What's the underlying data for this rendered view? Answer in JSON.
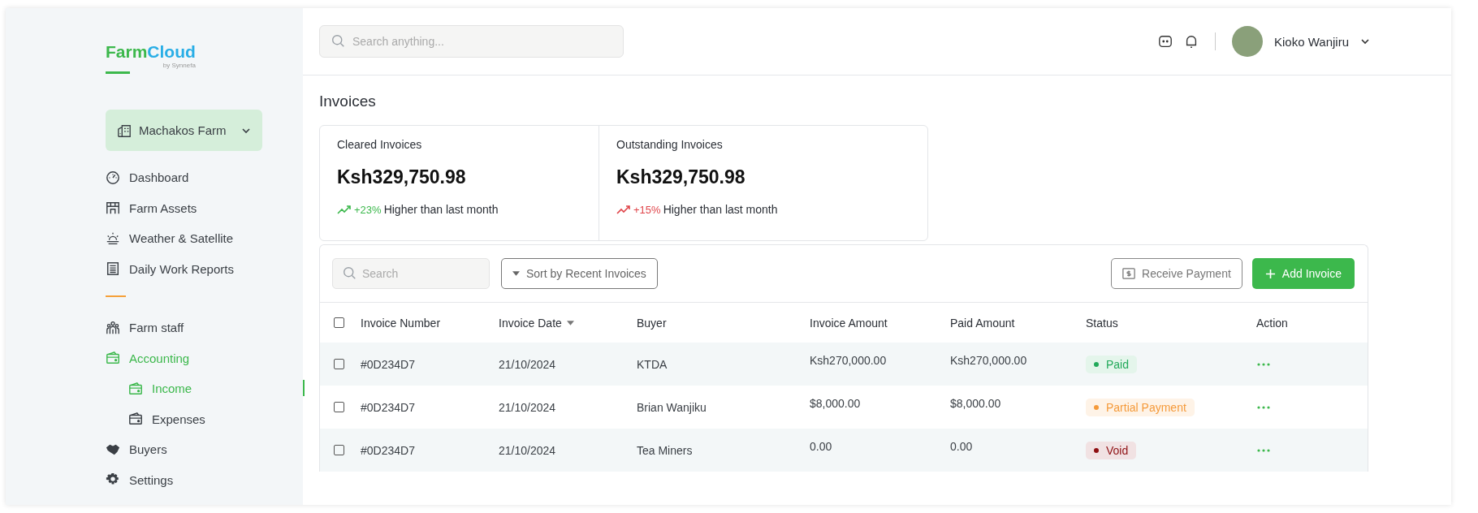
{
  "brand": {
    "first": "Farm",
    "second": "Cloud",
    "tagline": "by Synnefa"
  },
  "farm_selector": {
    "label": "Machakos Farm"
  },
  "sidebar": {
    "groups": [
      {
        "items": [
          {
            "label": "Dashboard",
            "selected": false
          },
          {
            "label": "Farm Assets",
            "selected": false
          },
          {
            "label": "Weather & Satellite",
            "selected": false
          },
          {
            "label": "Daily Work Reports",
            "selected": false
          }
        ]
      },
      {
        "items": [
          {
            "label": "Farm staff",
            "selected": false
          },
          {
            "label": "Accounting",
            "selected": true,
            "children": [
              {
                "label": "Income",
                "selected": true
              },
              {
                "label": "Expenses",
                "selected": false
              }
            ]
          },
          {
            "label": "Buyers",
            "selected": false
          },
          {
            "label": "Settings",
            "selected": false
          }
        ]
      }
    ]
  },
  "topbar": {
    "search": {
      "placeholder": "Search anything..."
    },
    "user": {
      "name": "Kioko Wanjiru"
    }
  },
  "page": {
    "title": "Invoices"
  },
  "stats": [
    {
      "title": "Cleared Invoices",
      "value": "Ksh329,750.98",
      "change": "+23%",
      "color": "#3cb84c",
      "note": "Higher than last month"
    },
    {
      "title": "Outstanding Invoices",
      "value": "Ksh329,750.98",
      "change": "+15%",
      "color": "#e0454a",
      "note": "Higher than last month"
    }
  ],
  "table": {
    "search": {
      "placeholder": "Search"
    },
    "sort_button": "Sort by Recent Invoices",
    "receive_button": "Receive Payment",
    "add_button": "Add Invoice",
    "select_all": {
      "checked": false
    },
    "columns": [
      {
        "label": "Invoice Number",
        "sorted": false
      },
      {
        "label": "Invoice Date",
        "sorted": true
      },
      {
        "label": "Buyer",
        "sorted": false
      },
      {
        "label": "Invoice Amount",
        "sorted": false
      },
      {
        "label": "Paid Amount",
        "sorted": false
      },
      {
        "label": "Status",
        "sorted": false
      },
      {
        "label": "Action",
        "sorted": false
      }
    ],
    "rows": [
      {
        "checked": false,
        "number": "#0D234D7",
        "date": "21/10/2024",
        "buyer": "KTDA",
        "invoice_amount": "Ksh270,000.00",
        "paid_amount": "Ksh270,000.00",
        "status": {
          "label": "Paid",
          "color": "#22a95a"
        }
      },
      {
        "checked": false,
        "number": "#0D234D7",
        "date": "21/10/2024",
        "buyer": "Brian Wanjiku",
        "invoice_amount": "$8,000.00",
        "paid_amount": "$8,000.00",
        "status": {
          "label": "Partial Payment",
          "color": "#f59a3a"
        }
      },
      {
        "checked": false,
        "number": "#0D234D7",
        "date": "21/10/2024",
        "buyer": "Tea Miners",
        "invoice_amount": "0.00",
        "paid_amount": "0.00",
        "status": {
          "label": "Void",
          "color": "#8e0f12"
        }
      }
    ]
  }
}
